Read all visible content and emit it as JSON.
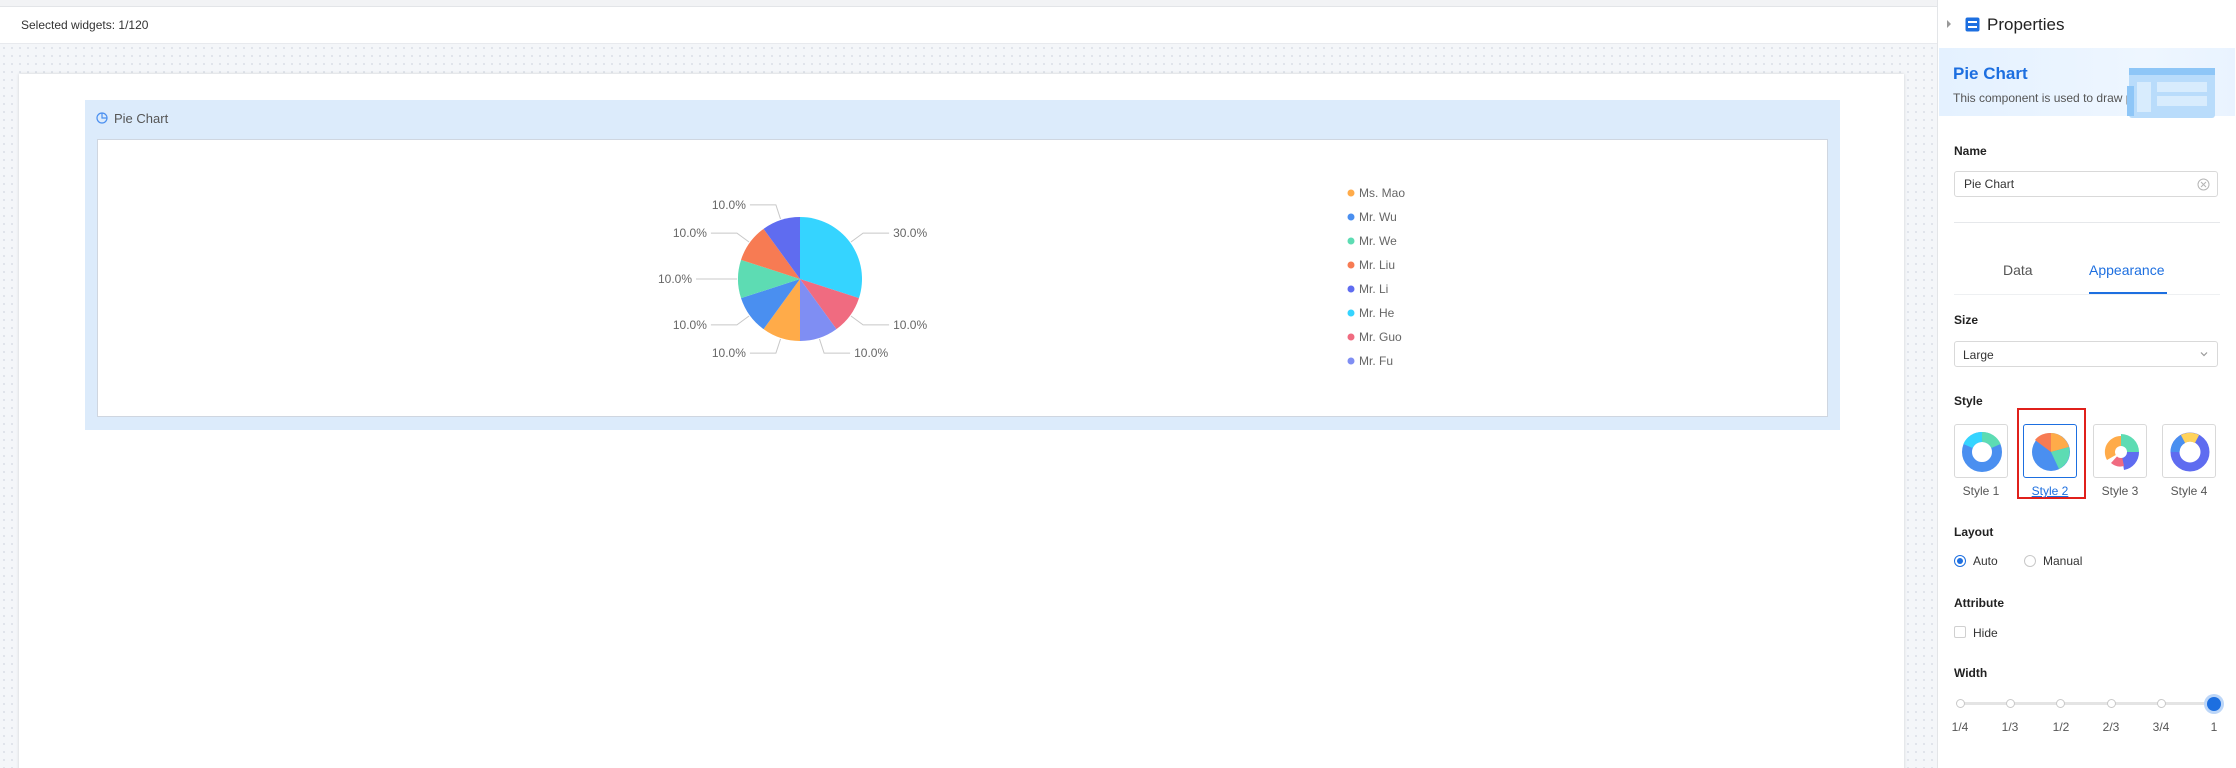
{
  "toolbar": {
    "selected_text": "Selected widgets: 1/120"
  },
  "widget": {
    "title": "Pie Chart",
    "icon": "pie-chart-icon"
  },
  "chart_data": {
    "type": "pie",
    "labels": [
      "Ms. Mao",
      "Mr. Wu",
      "Mr. We",
      "Mr. Liu",
      "Mr. Li",
      "Mr. He",
      "Mr. Guo",
      "Mr. Fu"
    ],
    "values": [
      10,
      10,
      10,
      10,
      10,
      30,
      10,
      10
    ],
    "data_labels": [
      "10.0%",
      "10.0%",
      "10.0%",
      "10.0%",
      "10.0%",
      "30.0%",
      "10.0%",
      "10.0%"
    ],
    "colors": [
      "#ffab49",
      "#4a8ff0",
      "#5ddcb3",
      "#f77b53",
      "#5f6cf0",
      "#35d4ff",
      "#f06b80",
      "#7f8ef3"
    ],
    "legend_position": "right",
    "title": ""
  },
  "panel": {
    "title": "Properties",
    "banner_title": "Pie Chart",
    "banner_desc": "This component is used to draw pie charts",
    "name_label": "Name",
    "name_value": "Pie Chart",
    "tabs": [
      {
        "label": "Data"
      },
      {
        "label": "Appearance"
      }
    ],
    "active_tab": "Appearance",
    "size_label": "Size",
    "size_value": "Large",
    "style_label": "Style",
    "styles": [
      {
        "label": "Style 1"
      },
      {
        "label": "Style 2"
      },
      {
        "label": "Style 3"
      },
      {
        "label": "Style 4"
      }
    ],
    "selected_style": "Style 2",
    "layout_label": "Layout",
    "layout_options": [
      {
        "label": "Auto"
      },
      {
        "label": "Manual"
      }
    ],
    "layout_selected": "Auto",
    "attribute_label": "Attribute",
    "hide_label": "Hide",
    "width_label": "Width",
    "width_ticks": [
      "1/4",
      "1/3",
      "1/2",
      "2/3",
      "3/4",
      "1"
    ],
    "width_value": "1"
  },
  "colors": {
    "accent": "#1d6fe0",
    "highlight": "#e0201b"
  }
}
